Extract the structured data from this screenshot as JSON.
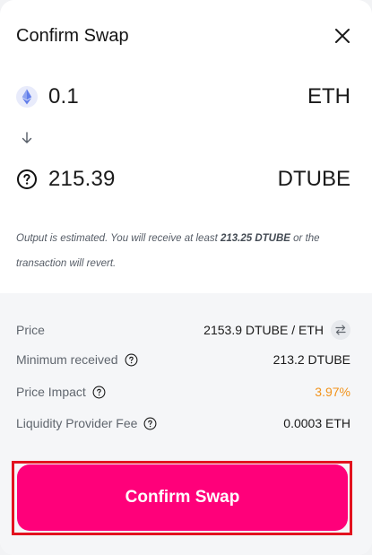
{
  "modal": {
    "title": "Confirm Swap",
    "close_icon": "close-icon"
  },
  "input": {
    "amount": "0.1",
    "symbol": "ETH",
    "icon": "eth-logo-icon"
  },
  "direction_icon": "arrow-down-icon",
  "output": {
    "amount": "215.39",
    "symbol": "DTUBE",
    "icon": "unknown-token-icon"
  },
  "note": {
    "prefix": "Output is estimated. You will receive at least ",
    "min_amount": "213.25 DTUBE",
    "suffix": " or the transaction will revert."
  },
  "details": {
    "price": {
      "label": "Price",
      "value": "2153.9 DTUBE / ETH",
      "icon": "swap-arrows-icon"
    },
    "minimum_received": {
      "label": "Minimum received",
      "value": "213.2 DTUBE",
      "icon": "question-icon"
    },
    "price_impact": {
      "label": "Price Impact",
      "value": "3.97%",
      "icon": "question-icon",
      "color": "#f2931b"
    },
    "lp_fee": {
      "label": "Liquidity Provider Fee",
      "value": "0.0003 ETH",
      "icon": "question-icon"
    }
  },
  "confirm_button": {
    "label": "Confirm Swap",
    "color": "#ff007a",
    "highlight_color": "#e2131f"
  }
}
